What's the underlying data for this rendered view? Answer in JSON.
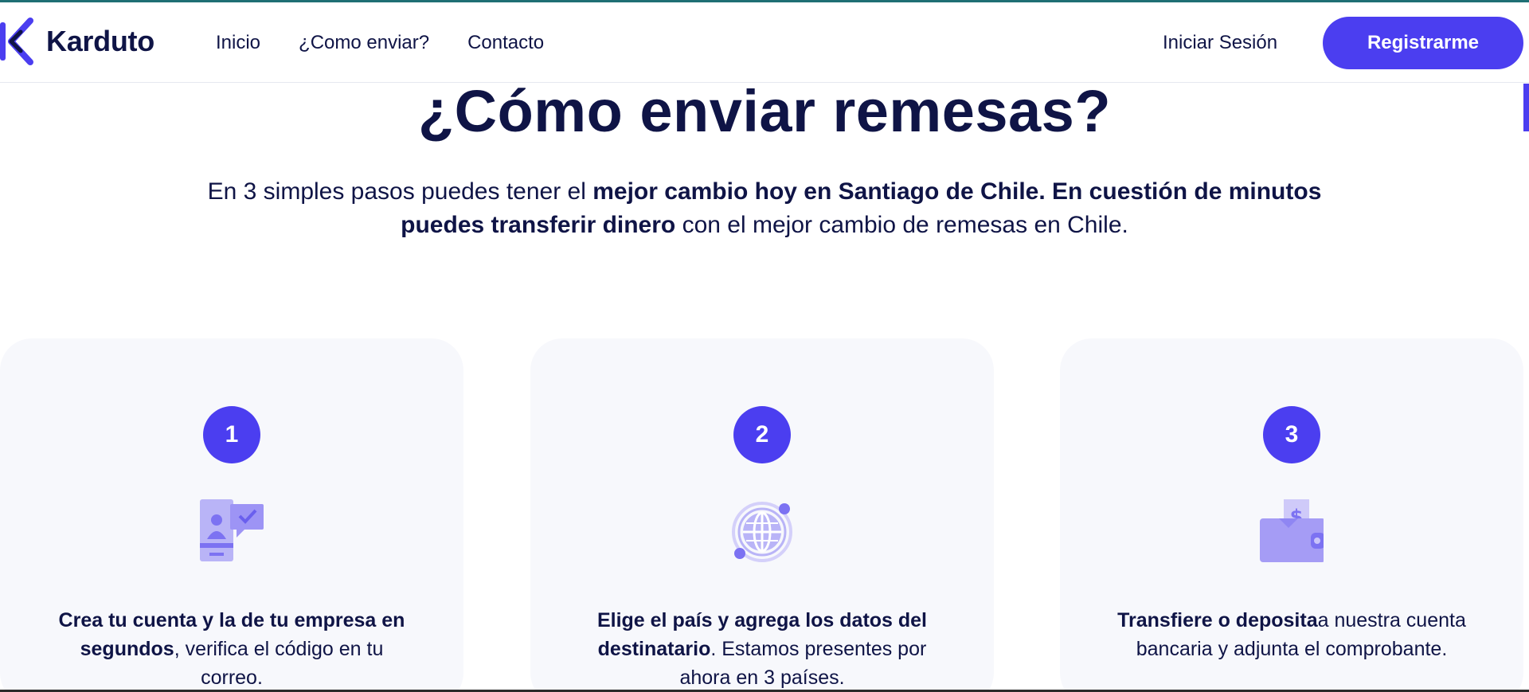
{
  "brand": {
    "name": "Karduto",
    "accent": "#4b3ef0",
    "text_color": "#0f1446",
    "card_bg": "#f7f8fc"
  },
  "nav": {
    "items": [
      {
        "label": "Inicio"
      },
      {
        "label": "¿Como enviar?"
      },
      {
        "label": "Contacto"
      }
    ],
    "login_label": "Iniciar Sesión",
    "register_label": "Registrarme"
  },
  "hero": {
    "title": "¿Cómo enviar remesas?",
    "subtitle_parts": [
      {
        "text": "En 3 simples pasos puedes tener el ",
        "bold": false
      },
      {
        "text": "mejor cambio hoy en Santiago de Chile. En cuestión de minutos puedes transferir dinero",
        "bold": true
      },
      {
        "text": " con el mejor cambio de remesas en Chile.",
        "bold": false
      }
    ]
  },
  "steps": [
    {
      "number": "1",
      "icon": "user-card-check-icon",
      "bold": "Crea tu cuenta y la de tu empresa en segundos",
      "rest": ", verifica el código en tu correo."
    },
    {
      "number": "2",
      "icon": "globe-orbit-icon",
      "bold": "Elige el país y agrega los datos del destinatario",
      "rest": ". Estamos presentes por ahora en 3 países."
    },
    {
      "number": "3",
      "icon": "wallet-dollar-icon",
      "bold": "Transfiere o deposita",
      "rest": "a nuestra cuenta bancaria y adjunta el comprobante."
    }
  ]
}
